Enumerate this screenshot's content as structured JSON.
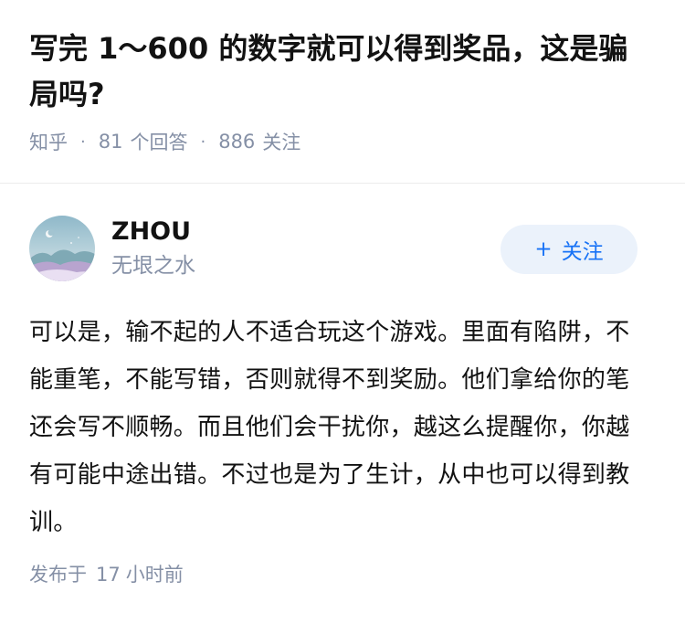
{
  "question": {
    "title": "写完 1～600 的数字就可以得到奖品，这是骗局吗?",
    "source": "知乎",
    "answers_count": "81",
    "answers_label": "个回答",
    "followers_count": "886",
    "followers_label": "关注",
    "separator": "·"
  },
  "answer": {
    "author_name": "ZHOU",
    "author_bio": "无垠之水",
    "follow_button": {
      "icon": "+",
      "label": "关注"
    },
    "content": "可以是，输不起的人不适合玩这个游戏。里面有陷阱，不能重笔，不能写错，否则就得不到奖励。他们拿给你的笔还会写不顺畅。而且他们会干扰你，越这么提醒你，你越有可能中途出错。不过也是为了生计，从中也可以得到教训。",
    "published_label": "发布于",
    "published_value": "17",
    "published_unit": "小时前"
  },
  "colors": {
    "meta_gray": "#8590a6",
    "accent_blue": "#1772f6",
    "follow_bg": "#ebf2fb",
    "text": "#121212"
  }
}
